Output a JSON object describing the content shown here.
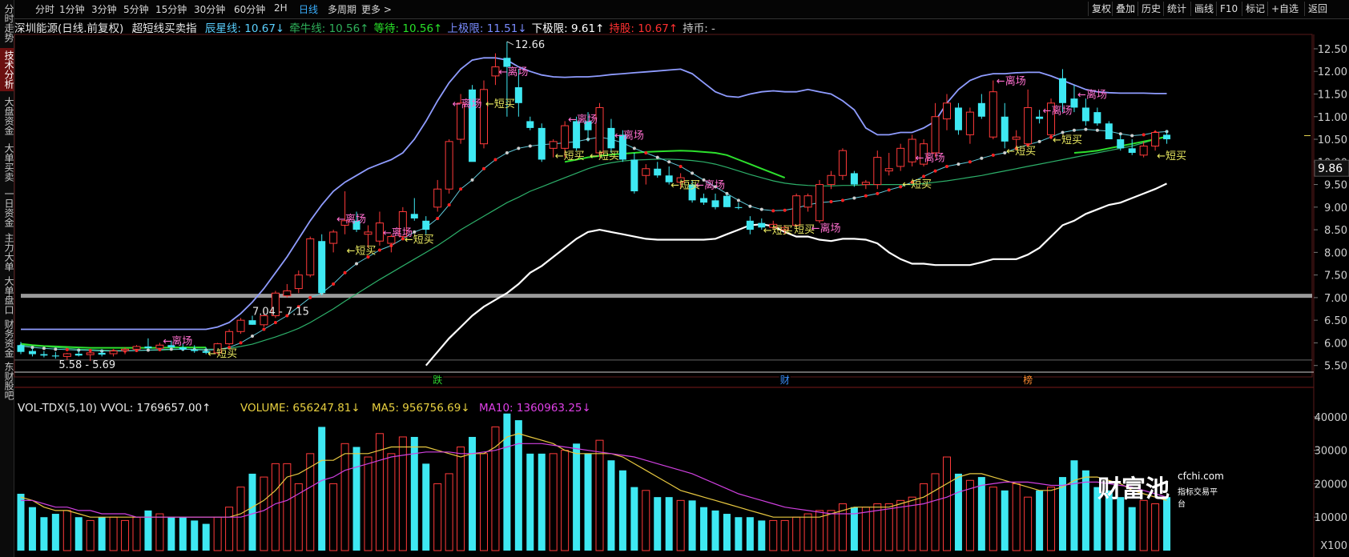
{
  "sidebar": {
    "items": [
      {
        "label": "分时走势",
        "active": false
      },
      {
        "label": "技术分析",
        "active": true
      },
      {
        "label": "大盘资金",
        "active": false
      },
      {
        "label": "大单买卖",
        "active": false
      },
      {
        "label": "一日资金",
        "active": false
      },
      {
        "label": "主力大单",
        "active": false
      },
      {
        "label": "大单盘口",
        "active": false
      },
      {
        "label": "财务资金",
        "active": false
      },
      {
        "label": "东财股吧",
        "active": false
      }
    ]
  },
  "toolbar": {
    "periods": [
      "分时",
      "1分钟",
      "3分钟",
      "5分钟",
      "15分钟",
      "30分钟",
      "60分钟",
      "2H",
      "日线",
      "多周期",
      "更多 >"
    ],
    "active_period": "日线",
    "right_buttons": [
      "复权",
      "叠加",
      "历史",
      "统计",
      "画线",
      "F10",
      "标记",
      "+自选",
      "返回"
    ]
  },
  "indicator": {
    "stock": "深圳能源(日线.前复权)",
    "name": "超短线买卖指",
    "items": [
      {
        "text": "辰星线: 10.67↓",
        "color": "#5ad0ff"
      },
      {
        "text": "牵牛线: 10.56↑",
        "color": "#2fb05a"
      },
      {
        "text": "等待: 10.56↑",
        "color": "#28e028"
      },
      {
        "text": "上极限: 11.51↓",
        "color": "#7a8cff"
      },
      {
        "text": "下极限: 9.61↑",
        "color": "#ffffff"
      },
      {
        "text": "持股: 10.67↑",
        "color": "#ff3030"
      },
      {
        "text": "持币: -",
        "color": "#cccccc"
      }
    ]
  },
  "price_axis": {
    "ticks": [
      "12.50",
      "12.00",
      "11.50",
      "11.00",
      "10.50",
      "10.00",
      "9.50",
      "9.00",
      "8.50",
      "8.00",
      "7.50",
      "7.00",
      "6.50",
      "6.00",
      "5.50"
    ],
    "current": "9.86"
  },
  "annotations": {
    "high_label": "12.66",
    "low_label": "5.58 - 5.69",
    "zone_label": "7.04 - 7.15",
    "leave": "←离场",
    "buy": "←短买",
    "buy_alt": "短买",
    "events": [
      "跌",
      "财",
      "榜"
    ]
  },
  "volume": {
    "title": "VOL-TDX(5,10) VVOL: 1769657.00↑",
    "volume_text": "VOLUME: 656247.81↓",
    "ma5_text": "MA5: 956756.69↓",
    "ma10_text": "MA10: 1360963.25↓",
    "axis": [
      "40000",
      "30000",
      "20000",
      "10000"
    ],
    "unit": "X100"
  },
  "watermark": {
    "brand": "财富池",
    "url": "cfchi.com",
    "slogan": "指标交易平台"
  },
  "colors": {
    "up": "#ff3a3a",
    "down": "#3ee8f2",
    "bg": "#000000",
    "upper": "#8f9cff",
    "lower": "#ffffff",
    "slow": "#2db06a",
    "wait": "#2de02d",
    "fast": "#60c8d8"
  },
  "chart_data": {
    "type": "candlestick",
    "title": "深圳能源(日线.前复权)",
    "ylim": [
      5.3,
      12.8
    ],
    "candles": [
      [
        5.95,
        6.02,
        5.75,
        5.8
      ],
      [
        5.82,
        5.88,
        5.7,
        5.75
      ],
      [
        5.75,
        5.82,
        5.68,
        5.72
      ],
      [
        5.72,
        5.8,
        5.65,
        5.7
      ],
      [
        5.7,
        5.78,
        5.62,
        5.76
      ],
      [
        5.76,
        5.84,
        5.7,
        5.72
      ],
      [
        5.74,
        5.82,
        5.6,
        5.78
      ],
      [
        5.78,
        5.86,
        5.7,
        5.74
      ],
      [
        5.76,
        5.86,
        5.7,
        5.82
      ],
      [
        5.83,
        5.9,
        5.75,
        5.86
      ],
      [
        5.86,
        5.95,
        5.8,
        5.92
      ],
      [
        5.92,
        6.1,
        5.88,
        5.88
      ],
      [
        5.88,
        6.0,
        5.82,
        5.95
      ],
      [
        5.95,
        6.05,
        5.9,
        5.9
      ],
      [
        5.9,
        5.98,
        5.82,
        5.85
      ],
      [
        5.85,
        5.95,
        5.78,
        5.82
      ],
      [
        5.82,
        5.9,
        5.75,
        5.78
      ],
      [
        5.78,
        6.0,
        5.75,
        5.98
      ],
      [
        5.98,
        6.3,
        5.95,
        6.25
      ],
      [
        6.25,
        6.55,
        6.2,
        6.5
      ],
      [
        6.5,
        6.6,
        6.4,
        6.4
      ],
      [
        6.4,
        6.7,
        6.35,
        6.6
      ],
      [
        6.6,
        7.15,
        6.55,
        7.1
      ],
      [
        7.04,
        7.3,
        7.0,
        7.15
      ],
      [
        7.2,
        7.6,
        7.1,
        7.5
      ],
      [
        7.5,
        8.35,
        7.45,
        8.3
      ],
      [
        8.25,
        8.4,
        7.05,
        7.1
      ],
      [
        8.2,
        8.5,
        8.0,
        8.45
      ],
      [
        8.6,
        9.35,
        8.4,
        8.7
      ],
      [
        8.7,
        8.9,
        8.45,
        8.5
      ],
      [
        8.4,
        8.6,
        8.1,
        8.45
      ],
      [
        8.25,
        8.9,
        8.15,
        8.65
      ],
      [
        8.2,
        8.4,
        8.0,
        8.35
      ],
      [
        8.35,
        9.0,
        8.3,
        8.9
      ],
      [
        8.85,
        9.2,
        8.7,
        8.75
      ],
      [
        8.7,
        8.8,
        8.4,
        8.5
      ],
      [
        9.0,
        9.6,
        8.9,
        9.4
      ],
      [
        9.4,
        10.5,
        9.3,
        10.45
      ],
      [
        10.5,
        11.5,
        10.4,
        11.3
      ],
      [
        11.6,
        11.7,
        10.1,
        10.0
      ],
      [
        10.4,
        11.8,
        10.3,
        11.6
      ],
      [
        11.9,
        12.4,
        11.7,
        12.1
      ],
      [
        12.3,
        12.66,
        11.0,
        12.1
      ],
      [
        11.65,
        12.05,
        11.0,
        11.3
      ],
      [
        10.9,
        11.0,
        10.7,
        10.75
      ],
      [
        10.75,
        10.85,
        10.0,
        10.05
      ],
      [
        10.3,
        10.5,
        10.1,
        10.45
      ],
      [
        10.3,
        10.9,
        10.1,
        10.8
      ],
      [
        10.9,
        11.0,
        10.25,
        10.3
      ],
      [
        10.9,
        11.1,
        10.45,
        10.7
      ],
      [
        10.2,
        11.3,
        10.1,
        11.2
      ],
      [
        10.75,
        10.95,
        10.2,
        10.3
      ],
      [
        10.6,
        10.7,
        10.0,
        10.05
      ],
      [
        10.05,
        10.2,
        9.3,
        9.35
      ],
      [
        9.7,
        9.95,
        9.5,
        9.85
      ],
      [
        9.85,
        10.0,
        9.65,
        9.7
      ],
      [
        9.7,
        9.9,
        9.5,
        9.55
      ],
      [
        9.55,
        9.75,
        9.4,
        9.65
      ],
      [
        9.5,
        9.6,
        9.1,
        9.15
      ],
      [
        9.2,
        9.3,
        9.05,
        9.1
      ],
      [
        9.15,
        9.3,
        8.95,
        9.0
      ],
      [
        9.25,
        9.3,
        9.0,
        9.0
      ],
      [
        9.0,
        9.1,
        8.95,
        8.98
      ],
      [
        8.7,
        8.8,
        8.4,
        8.5
      ],
      [
        8.65,
        8.75,
        8.5,
        8.55
      ],
      [
        8.55,
        8.7,
        8.5,
        8.62
      ],
      [
        8.5,
        8.6,
        8.4,
        8.55
      ],
      [
        8.6,
        9.3,
        8.55,
        9.25
      ],
      [
        9.0,
        9.3,
        8.9,
        9.25
      ],
      [
        8.7,
        9.6,
        8.65,
        9.5
      ],
      [
        9.5,
        9.8,
        9.4,
        9.7
      ],
      [
        9.7,
        10.3,
        9.6,
        10.25
      ],
      [
        9.75,
        9.8,
        9.45,
        9.5
      ],
      [
        9.5,
        9.6,
        9.4,
        9.55
      ],
      [
        9.5,
        10.25,
        9.4,
        10.1
      ],
      [
        9.8,
        10.2,
        9.7,
        9.85
      ],
      [
        9.9,
        10.4,
        9.8,
        10.3
      ],
      [
        10.0,
        10.6,
        9.9,
        10.5
      ],
      [
        9.95,
        10.5,
        9.9,
        10.4
      ],
      [
        10.2,
        11.3,
        10.1,
        11.0
      ],
      [
        10.95,
        11.5,
        10.7,
        11.3
      ],
      [
        11.2,
        11.3,
        10.6,
        10.7
      ],
      [
        10.6,
        11.2,
        10.4,
        11.1
      ],
      [
        11.3,
        11.5,
        10.95,
        11.0
      ],
      [
        10.55,
        11.8,
        10.5,
        11.55
      ],
      [
        11.0,
        11.3,
        10.3,
        10.45
      ],
      [
        10.5,
        10.7,
        10.3,
        10.55
      ],
      [
        10.4,
        11.6,
        10.35,
        11.2
      ],
      [
        11.0,
        11.15,
        10.85,
        10.95
      ],
      [
        10.6,
        11.4,
        10.5,
        11.3
      ],
      [
        11.85,
        12.05,
        11.1,
        11.3
      ],
      [
        11.4,
        11.7,
        11.1,
        11.2
      ],
      [
        11.2,
        11.4,
        10.8,
        10.9
      ],
      [
        11.1,
        11.2,
        10.8,
        10.85
      ],
      [
        10.85,
        10.9,
        10.5,
        10.5
      ],
      [
        10.5,
        10.6,
        10.25,
        10.3
      ],
      [
        10.3,
        10.5,
        10.15,
        10.2
      ],
      [
        10.15,
        10.45,
        10.1,
        10.35
      ],
      [
        10.35,
        10.7,
        10.25,
        10.65
      ],
      [
        10.6,
        10.7,
        10.4,
        10.5
      ]
    ],
    "volume": [
      1.7,
      1.3,
      1.0,
      1.1,
      1.2,
      1.0,
      0.9,
      1.0,
      1.0,
      0.9,
      1.0,
      1.2,
      1.1,
      1.0,
      1.0,
      0.9,
      0.8,
      1.0,
      1.3,
      1.9,
      2.3,
      2.2,
      2.6,
      2.6,
      2.0,
      2.9,
      3.7,
      2.0,
      3.2,
      3.1,
      2.8,
      3.5,
      2.9,
      3.4,
      3.4,
      2.6,
      2.0,
      2.3,
      3.1,
      3.4,
      2.9,
      3.7,
      4.1,
      3.9,
      2.9,
      2.9,
      2.9,
      3.0,
      3.2,
      2.9,
      3.3,
      2.7,
      2.4,
      1.9,
      1.8,
      1.6,
      1.6,
      1.5,
      1.5,
      1.3,
      1.2,
      1.1,
      1.0,
      1.0,
      0.9,
      0.9,
      0.9,
      1.0,
      1.1,
      1.2,
      1.2,
      1.4,
      1.3,
      1.3,
      1.4,
      1.4,
      1.5,
      1.6,
      2.0,
      2.3,
      2.8,
      2.3,
      2.1,
      2.2,
      1.9,
      1.8,
      2.0,
      1.6,
      1.8,
      1.9,
      2.2,
      2.7,
      2.4,
      1.9,
      1.8,
      1.6,
      1.3,
      1.5,
      1.4,
      1.6
    ],
    "upper_band": [
      6.3,
      6.3,
      6.3,
      6.3,
      6.3,
      6.3,
      6.3,
      6.3,
      6.3,
      6.3,
      6.3,
      6.3,
      6.3,
      6.3,
      6.3,
      6.3,
      6.3,
      6.35,
      6.45,
      6.65,
      6.9,
      7.2,
      7.55,
      7.9,
      8.3,
      8.7,
      9.05,
      9.35,
      9.55,
      9.7,
      9.85,
      9.95,
      10.05,
      10.2,
      10.5,
      10.9,
      11.35,
      11.75,
      12.05,
      12.25,
      12.3,
      12.3,
      12.25,
      12.1,
      12.0,
      11.92,
      11.88,
      11.87,
      11.88,
      11.88,
      11.9,
      11.93,
      11.95,
      11.97,
      11.99,
      12.01,
      12.03,
      12.05,
      11.95,
      11.75,
      11.55,
      11.45,
      11.43,
      11.5,
      11.55,
      11.57,
      11.55,
      11.55,
      11.6,
      11.55,
      11.5,
      11.35,
      11.15,
      10.75,
      10.6,
      10.6,
      10.65,
      10.65,
      10.75,
      10.9,
      11.3,
      11.6,
      11.8,
      11.9,
      11.95,
      11.95,
      11.97,
      11.98,
      11.98,
      11.9,
      11.8,
      11.7,
      11.6,
      11.55,
      11.53,
      11.52,
      11.52,
      11.52,
      11.51,
      11.51
    ],
    "lower_band": [
      null,
      null,
      null,
      null,
      null,
      null,
      null,
      null,
      null,
      null,
      null,
      null,
      null,
      null,
      null,
      null,
      null,
      null,
      null,
      null,
      null,
      null,
      null,
      null,
      null,
      null,
      null,
      null,
      null,
      null,
      null,
      null,
      null,
      null,
      null,
      5.5,
      5.8,
      6.1,
      6.35,
      6.6,
      6.8,
      6.95,
      7.1,
      7.3,
      7.55,
      7.7,
      7.9,
      8.1,
      8.3,
      8.45,
      8.5,
      8.45,
      8.4,
      8.35,
      8.3,
      8.28,
      8.28,
      8.28,
      8.28,
      8.28,
      8.3,
      8.4,
      8.5,
      8.6,
      8.62,
      8.58,
      8.45,
      8.35,
      8.35,
      8.28,
      8.25,
      8.3,
      8.3,
      8.28,
      8.2,
      8.0,
      7.85,
      7.75,
      7.75,
      7.72,
      7.72,
      7.72,
      7.72,
      7.78,
      7.85,
      7.85,
      7.85,
      7.95,
      8.1,
      8.35,
      8.6,
      8.7,
      8.85,
      8.95,
      9.05,
      9.1,
      9.2,
      9.3,
      9.4,
      9.52
    ],
    "fast_line": [
      5.93,
      5.9,
      5.88,
      5.86,
      5.85,
      5.84,
      5.83,
      5.82,
      5.82,
      5.82,
      5.83,
      5.84,
      5.85,
      5.86,
      5.86,
      5.85,
      5.84,
      5.85,
      5.9,
      6.0,
      6.15,
      6.3,
      6.45,
      6.6,
      6.8,
      7.0,
      7.1,
      7.3,
      7.55,
      7.75,
      7.9,
      8.05,
      8.15,
      8.3,
      8.45,
      8.55,
      8.75,
      9.05,
      9.4,
      9.6,
      9.85,
      10.05,
      10.2,
      10.3,
      10.35,
      10.38,
      10.4,
      10.42,
      10.45,
      10.5,
      10.55,
      10.5,
      10.42,
      10.3,
      10.2,
      10.1,
      10.0,
      9.9,
      9.75,
      9.6,
      9.45,
      9.3,
      9.15,
      9.02,
      8.95,
      8.92,
      8.93,
      8.98,
      9.05,
      9.1,
      9.12,
      9.15,
      9.2,
      9.25,
      9.3,
      9.38,
      9.45,
      9.55,
      9.68,
      9.8,
      9.9,
      9.95,
      10.0,
      10.08,
      10.15,
      10.2,
      10.3,
      10.38,
      10.45,
      10.55,
      10.65,
      10.7,
      10.72,
      10.7,
      10.68,
      10.62,
      10.58,
      10.6,
      10.65,
      10.67
    ],
    "slow_line": [
      5.95,
      5.93,
      5.92,
      5.9,
      5.88,
      5.86,
      5.85,
      5.84,
      5.83,
      5.83,
      5.83,
      5.84,
      5.84,
      5.85,
      5.86,
      5.86,
      5.86,
      5.86,
      5.88,
      5.92,
      5.97,
      6.05,
      6.13,
      6.22,
      6.32,
      6.45,
      6.6,
      6.75,
      6.92,
      7.08,
      7.24,
      7.4,
      7.55,
      7.7,
      7.85,
      8.0,
      8.15,
      8.32,
      8.5,
      8.65,
      8.8,
      8.95,
      9.1,
      9.22,
      9.35,
      9.45,
      9.55,
      9.65,
      9.75,
      9.85,
      9.93,
      9.98,
      10.02,
      10.04,
      10.05,
      10.06,
      10.06,
      10.05,
      10.03,
      10.0,
      9.95,
      9.88,
      9.8,
      9.72,
      9.65,
      9.58,
      9.53,
      9.5,
      9.48,
      9.47,
      9.47,
      9.48,
      9.48,
      9.5,
      9.5,
      9.5,
      9.5,
      9.5,
      9.52,
      9.55,
      9.58,
      9.62,
      9.66,
      9.7,
      9.75,
      9.8,
      9.85,
      9.9,
      9.95,
      10.0,
      10.05,
      10.1,
      10.15,
      10.2,
      10.25,
      10.3,
      10.35,
      10.42,
      10.5,
      10.56
    ],
    "wait_segments": [
      {
        "from": 0,
        "to": 16,
        "values": [
          5.98,
          5.95,
          5.93,
          5.92,
          5.91,
          5.9,
          5.89,
          5.89,
          5.89,
          5.89,
          5.89,
          5.89,
          5.89,
          5.9,
          5.9,
          5.9,
          5.9
        ]
      },
      {
        "from": 47,
        "to": 66,
        "values": [
          10.0,
          10.05,
          10.1,
          10.13,
          10.16,
          10.18,
          10.2,
          10.22,
          10.23,
          10.24,
          10.25,
          10.24,
          10.22,
          10.2,
          10.15,
          10.05,
          9.95,
          9.85,
          9.75,
          9.65
        ]
      },
      {
        "from": 91,
        "to": 99,
        "values": [
          10.2,
          10.22,
          10.25,
          10.3,
          10.35,
          10.4,
          10.45,
          10.5,
          10.56
        ]
      }
    ],
    "volume_ma5": [
      1.6,
      1.5,
      1.3,
      1.2,
      1.2,
      1.1,
      1.0,
      1.0,
      1.0,
      1.0,
      1.0,
      1.0,
      1.0,
      1.0,
      1.0,
      1.0,
      1.0,
      1.0,
      1.0,
      1.1,
      1.3,
      1.5,
      1.8,
      2.2,
      2.3,
      2.5,
      2.7,
      2.7,
      2.9,
      2.9,
      2.9,
      3.0,
      3.1,
      3.1,
      3.1,
      3.1,
      3.0,
      2.9,
      2.8,
      2.9,
      2.9,
      3.1,
      3.4,
      3.5,
      3.4,
      3.3,
      3.2,
      3.0,
      2.9,
      2.9,
      2.9,
      2.9,
      2.8,
      2.6,
      2.4,
      2.2,
      2.0,
      1.8,
      1.7,
      1.6,
      1.5,
      1.4,
      1.3,
      1.2,
      1.1,
      1.0,
      1.0,
      1.0,
      1.0,
      1.0,
      1.1,
      1.2,
      1.3,
      1.3,
      1.3,
      1.3,
      1.4,
      1.5,
      1.6,
      1.8,
      2.0,
      2.2,
      2.3,
      2.3,
      2.2,
      2.1,
      2.0,
      1.9,
      1.8,
      1.8,
      1.9,
      2.1,
      2.2,
      2.2,
      2.1,
      2.0,
      1.8,
      1.7,
      1.6,
      1.5
    ],
    "volume_ma10": [
      1.5,
      1.5,
      1.4,
      1.3,
      1.3,
      1.2,
      1.2,
      1.1,
      1.1,
      1.1,
      1.0,
      1.0,
      1.0,
      1.0,
      1.0,
      1.0,
      1.0,
      1.0,
      1.0,
      1.0,
      1.1,
      1.2,
      1.4,
      1.5,
      1.7,
      1.9,
      2.1,
      2.2,
      2.4,
      2.5,
      2.6,
      2.7,
      2.8,
      2.85,
      2.9,
      2.95,
      2.95,
      2.95,
      2.9,
      2.9,
      2.95,
      3.0,
      3.1,
      3.2,
      3.2,
      3.2,
      3.15,
      3.1,
      3.05,
      3.0,
      2.95,
      2.9,
      2.85,
      2.8,
      2.7,
      2.6,
      2.5,
      2.4,
      2.3,
      2.15,
      2.0,
      1.85,
      1.7,
      1.6,
      1.5,
      1.4,
      1.3,
      1.25,
      1.2,
      1.15,
      1.1,
      1.1,
      1.1,
      1.15,
      1.2,
      1.25,
      1.3,
      1.35,
      1.4,
      1.5,
      1.6,
      1.75,
      1.85,
      1.95,
      2.0,
      2.05,
      2.05,
      2.05,
      2.0,
      1.95,
      1.95,
      2.0,
      2.05,
      2.05,
      2.0,
      1.95,
      1.9,
      1.8,
      1.7,
      1.6
    ]
  }
}
